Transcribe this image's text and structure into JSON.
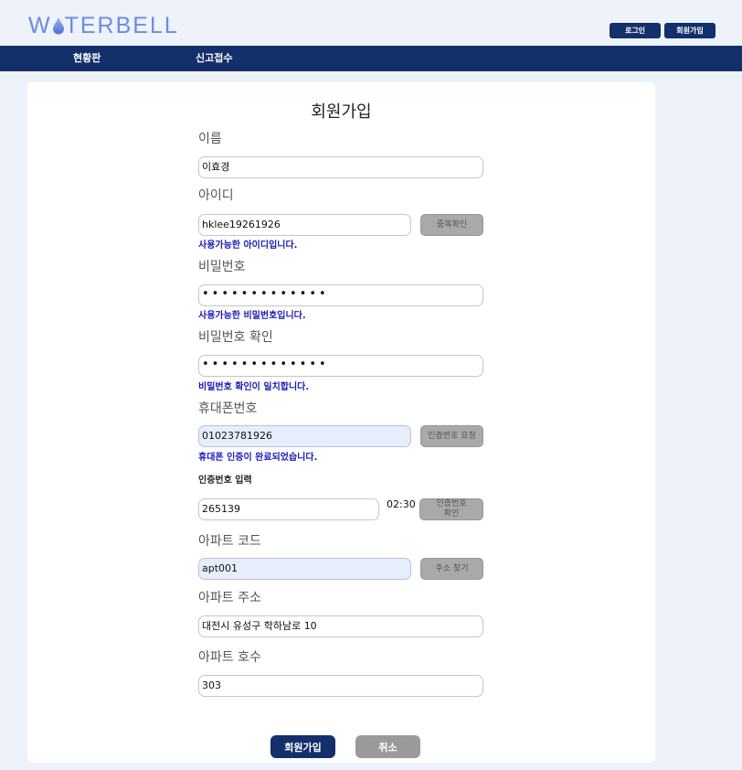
{
  "header": {
    "logo_text_a": "W",
    "logo_text_b": "TERBELL",
    "login_label": "로그인",
    "signup_label": "회원가입"
  },
  "nav": {
    "items": [
      {
        "label": "현황판"
      },
      {
        "label": "신고접수"
      }
    ]
  },
  "form": {
    "title": "회원가입",
    "name": {
      "label": "이름",
      "value": "이효경"
    },
    "userid": {
      "label": "아이디",
      "value": "hklee19261926",
      "check_button": "중복확인",
      "message": "사용가능한 아이디입니다."
    },
    "password": {
      "label": "비밀번호",
      "value": "•••••••••••••",
      "message": "사용가능한 비밀번호입니다."
    },
    "password_confirm": {
      "label": "비밀번호 확인",
      "value": "•••••••••••••",
      "message": "비밀번호 확인이 일치합니다."
    },
    "phone": {
      "label": "휴대폰번호",
      "value": "01023781926",
      "request_button": "인증번호 요청",
      "message": "휴대폰 인증이 완료되었습니다."
    },
    "auth_code": {
      "label": "인증번호 입력",
      "value": "265139",
      "timer": "02:30",
      "confirm_button_line1": "인증번호",
      "confirm_button_line2": "확인"
    },
    "apt_code": {
      "label": "아파트 코드",
      "value": "apt001",
      "search_button": "주소 찾기"
    },
    "apt_address": {
      "label": "아파트 주소",
      "value": "대전시 유성구 학하남로 10"
    },
    "apt_unit": {
      "label": "아파트 호수",
      "value": "303"
    },
    "submit_label": "회원가입",
    "cancel_label": "취소"
  },
  "colors": {
    "primary": "#13306b",
    "message": "#1a1ab8",
    "background": "#eef3fb",
    "logo": "#6c8ae0"
  }
}
